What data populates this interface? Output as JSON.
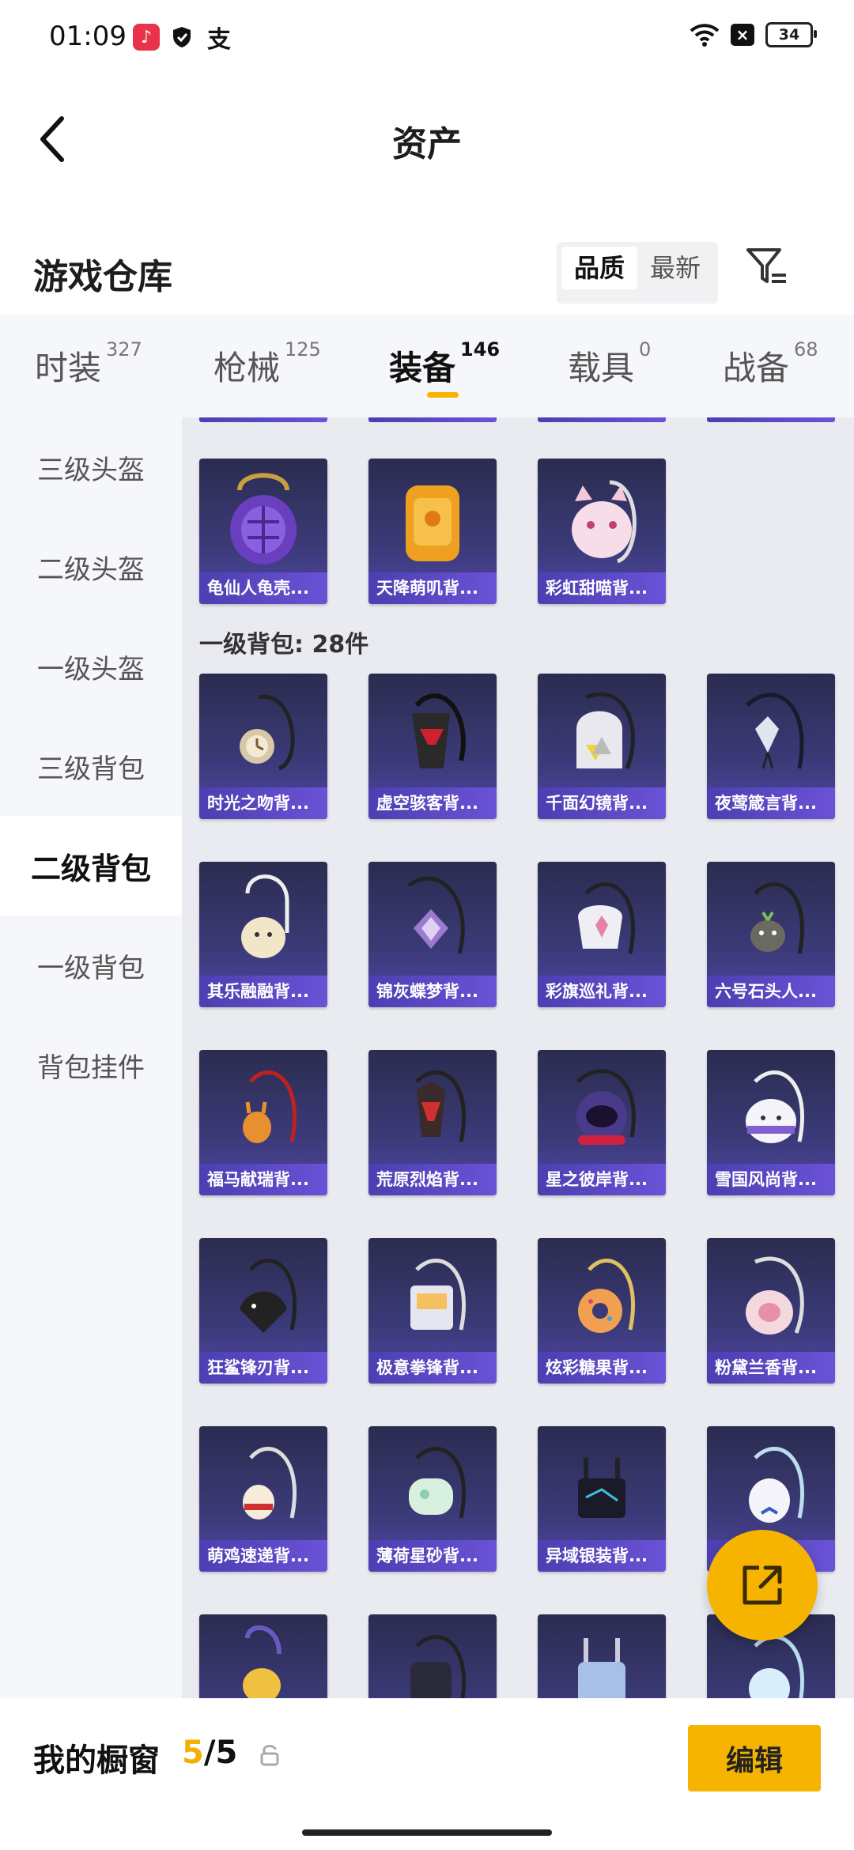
{
  "status": {
    "time": "01:09",
    "battery": "34",
    "apps": [
      "music-app-icon",
      "shield-app-icon",
      "alipay-app-icon"
    ],
    "alipay_glyph": "支"
  },
  "header": {
    "title": "资产"
  },
  "section": {
    "title": "游戏仓库"
  },
  "sort": {
    "options": [
      "品质",
      "最新"
    ],
    "active": "品质"
  },
  "tabs": [
    {
      "label": "时装",
      "count": "327"
    },
    {
      "label": "枪械",
      "count": "125"
    },
    {
      "label": "装备",
      "count": "146",
      "active": true
    },
    {
      "label": "载具",
      "count": "0"
    },
    {
      "label": "战备",
      "count": "68"
    }
  ],
  "sidebar": {
    "items": [
      "三级头盔",
      "二级头盔",
      "一级头盔",
      "三级背包",
      "二级背包",
      "一级背包",
      "背包挂件"
    ],
    "active": "二级背包"
  },
  "grid": {
    "group_top_items": [
      "龟仙人龟壳...",
      "天降萌叽背...",
      "彩虹甜喵背..."
    ],
    "group_label": "一级背包: 28件",
    "items": [
      "时光之吻背...",
      "虚空骇客背...",
      "千面幻镜背...",
      "夜莺箴言背...",
      "其乐融融背...",
      "锦灰蝶梦背...",
      "彩旗巡礼背...",
      "六号石头人...",
      "福马献瑞背...",
      "荒原烈焰背...",
      "星之彼岸背...",
      "雪国风尚背...",
      "狂鲨锋刃背...",
      "极意拳锋背...",
      "炫彩糖果背...",
      "粉黛兰香背...",
      "萌鸡速递背...",
      "薄荷星砂背...",
      "异域银装背...",
      ""
    ]
  },
  "bottom": {
    "showcase_label": "我的橱窗",
    "current": "5",
    "separator": "/",
    "total": "5",
    "edit_label": "编辑"
  },
  "colors": {
    "accent": "#f6b400",
    "card_bg": "#3b3a78",
    "card_label": "#5a4ac4"
  }
}
